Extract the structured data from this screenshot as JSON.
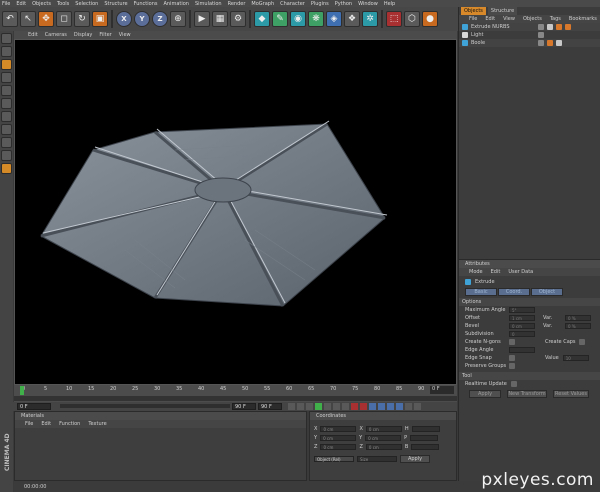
{
  "menubar": {
    "items": [
      "File",
      "Edit",
      "Objects",
      "Tools",
      "Selection",
      "Structure",
      "Functions",
      "Animation",
      "Simulation",
      "Render",
      "MoGraph",
      "Character",
      "Plugins",
      "Python",
      "Window",
      "Help"
    ]
  },
  "viewport": {
    "menu": [
      "Edit",
      "Cameras",
      "Display",
      "Filter",
      "View"
    ]
  },
  "timeline": {
    "ticks": [
      "0",
      "5",
      "10",
      "15",
      "20",
      "25",
      "30",
      "35",
      "40",
      "45",
      "50",
      "55",
      "60",
      "65",
      "70",
      "75",
      "80",
      "85",
      "90"
    ],
    "frame_end": "0 F"
  },
  "transport": {
    "current_frame": "0 F",
    "end_frame_a": "90 F",
    "end_frame_b": "90 F"
  },
  "materials": {
    "title": "Materials",
    "menu": [
      "File",
      "Edit",
      "Function",
      "Texture"
    ]
  },
  "coordinates": {
    "title": "Coordinates",
    "rows": [
      {
        "a": "X",
        "b": "X",
        "c": "H"
      },
      {
        "a": "Y",
        "b": "Y",
        "c": "P"
      },
      {
        "a": "Z",
        "b": "Z",
        "c": "B"
      }
    ],
    "field_placeholder": "0 cm",
    "mode": "Object (Rel)",
    "size": "Size",
    "apply": "Apply"
  },
  "objects": {
    "tabs": [
      "Objects",
      "Structure"
    ],
    "menu": [
      "File",
      "Edit",
      "View",
      "Objects",
      "Tags",
      "Bookmarks"
    ],
    "items": [
      {
        "name": "Extrude NURBS",
        "color": "#3fa3d8"
      },
      {
        "name": "Light",
        "color": "#d8d8d8"
      },
      {
        "name": "Boole",
        "color": "#3fa3d8"
      }
    ]
  },
  "attributes": {
    "title": "Attributes",
    "menu": [
      "Mode",
      "Edit",
      "User Data"
    ],
    "object_name": "Extrude",
    "tabs": [
      "Basic",
      "Coord.",
      "Object"
    ],
    "section_options": "Options",
    "rows": [
      {
        "label": "Maximum Angle",
        "value": "5°"
      },
      {
        "label": "Offset",
        "value": "1 cm",
        "extra_label": "Var.",
        "extra_value": "0 %"
      },
      {
        "label": "Bevel",
        "value": "0 cm",
        "extra_label": "Var.",
        "extra_value": "0 %"
      },
      {
        "label": "Subdivision",
        "value": "0"
      },
      {
        "label": "Create N-gons",
        "value": "",
        "extra_label": "Create Caps",
        "extra_value": ""
      },
      {
        "label": "Edge Angle",
        "value": ""
      },
      {
        "label": "Edge Snap",
        "value": "",
        "extra_label": "Value",
        "extra_value": "10"
      },
      {
        "label": "Preserve Groups",
        "value": ""
      }
    ],
    "section_tool": "Tool",
    "realtime": "Realtime Update",
    "buttons": [
      "Apply",
      "New Transform",
      "Reset Values"
    ]
  },
  "statusbar": {
    "time": "00:00:00"
  },
  "brand": "CINEMA 4D",
  "watermark": "pxleyes.com"
}
